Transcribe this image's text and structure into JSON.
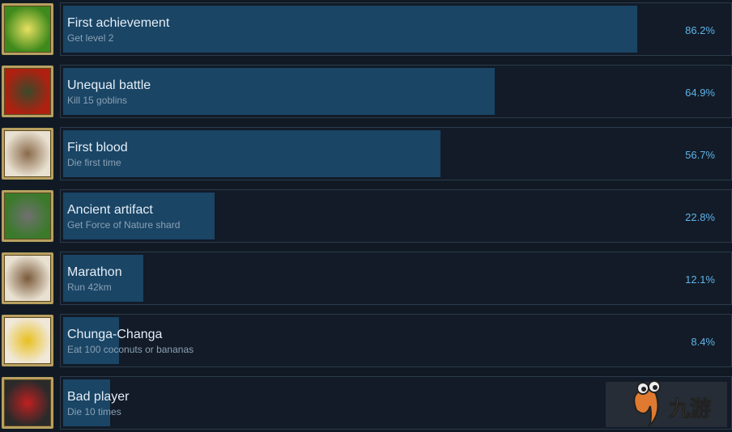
{
  "achievements": [
    {
      "title": "First achievement",
      "description": "Get level 2",
      "percent": "86.2%",
      "value": 86.2,
      "icon": "campfire-icon",
      "icon_colors": [
        "#3f8a1c",
        "#e8e060"
      ]
    },
    {
      "title": "Unequal battle",
      "description": "Kill 15 goblins",
      "percent": "64.9%",
      "value": 64.9,
      "icon": "sword-goblin-icon",
      "icon_colors": [
        "#b02010",
        "#3a4a2a"
      ]
    },
    {
      "title": "First blood",
      "description": "Die first time",
      "percent": "56.7%",
      "value": 56.7,
      "icon": "crossbones-icon",
      "icon_colors": [
        "#e8e0d0",
        "#8a6a4a"
      ]
    },
    {
      "title": "Ancient artifact",
      "description": "Get Force of Nature shard",
      "percent": "22.8%",
      "value": 22.8,
      "icon": "artifact-icon",
      "icon_colors": [
        "#3a7a2a",
        "#707070"
      ]
    },
    {
      "title": "Marathon",
      "description": "Run 42km",
      "percent": "12.1%",
      "value": 12.1,
      "icon": "runner-icon",
      "icon_colors": [
        "#e8e0d0",
        "#7a5a3a"
      ]
    },
    {
      "title": "Chunga-Changa",
      "description": "Eat 100 coconuts or bananas",
      "percent": "8.4%",
      "value": 8.4,
      "icon": "banana-coconut-icon",
      "icon_colors": [
        "#f0e8d8",
        "#e8c020"
      ]
    },
    {
      "title": "Bad player",
      "description": "Die 10 times",
      "percent": "",
      "value": 7.0,
      "icon": "reaper-icon",
      "icon_colors": [
        "#2a2a2a",
        "#c02020"
      ]
    }
  ],
  "watermark": {
    "text": "九游",
    "color": "#e07a30",
    "text_color": "#e8b830"
  }
}
